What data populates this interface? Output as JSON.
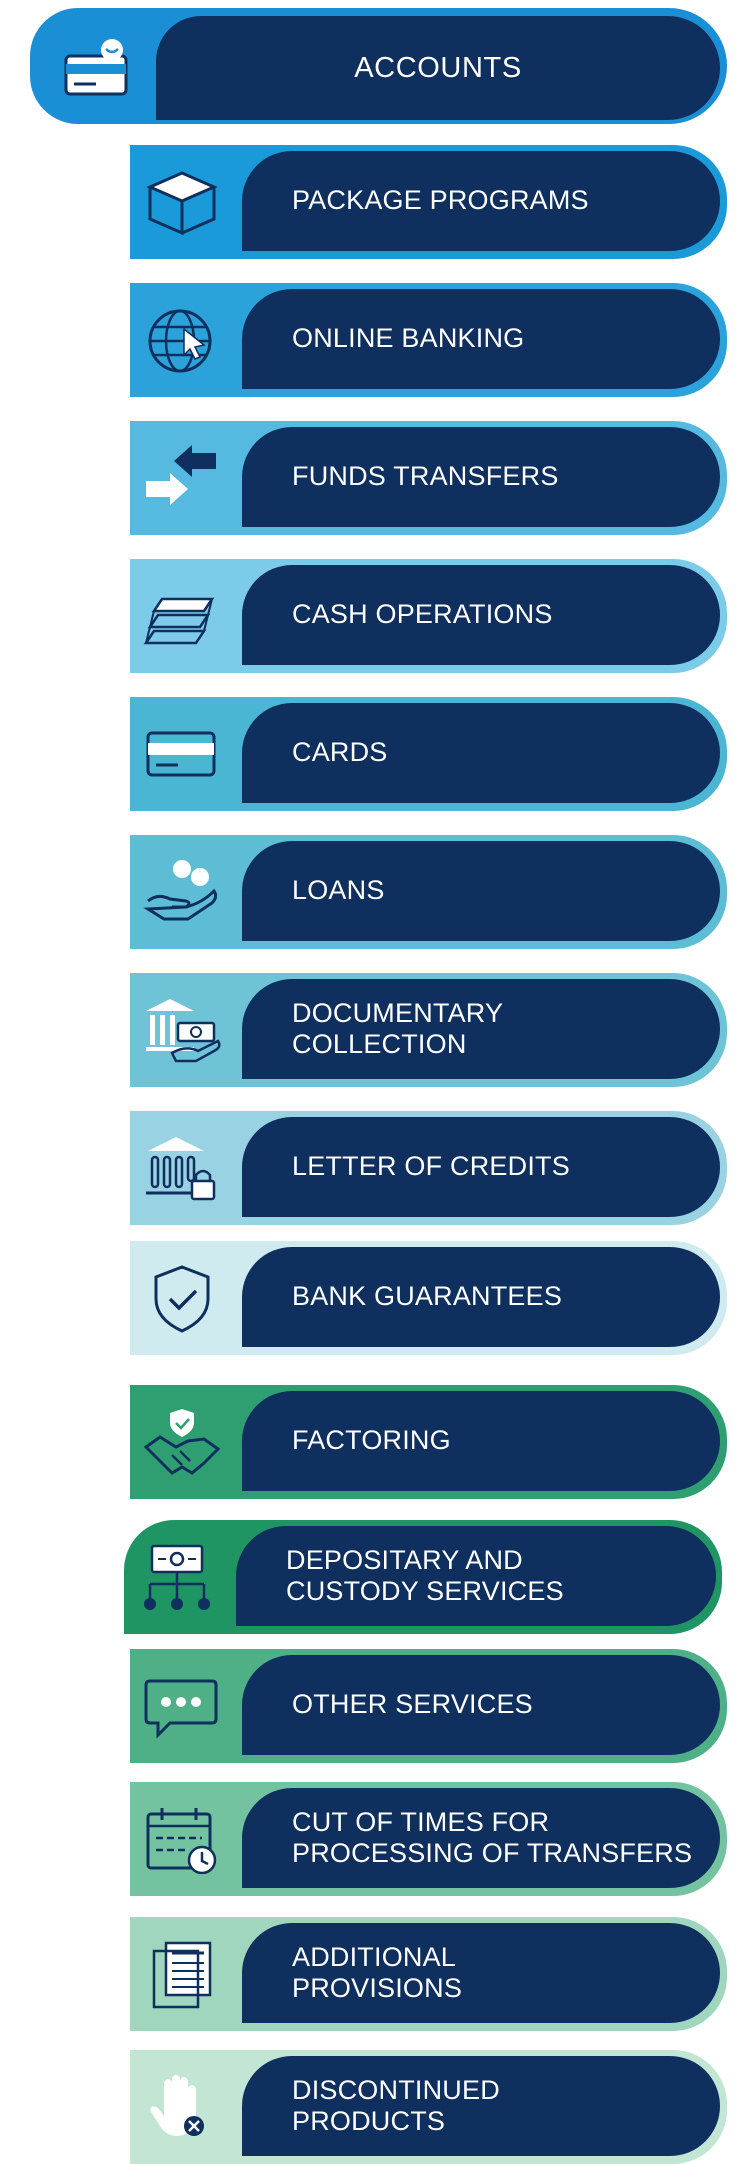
{
  "header": {
    "label": "ACCOUNTS",
    "icon": "account-icon",
    "color": "#1a8fd6"
  },
  "items": [
    {
      "label": "PACKAGE PROGRAMS",
      "icon": "box-icon",
      "color": "#1a9ad8"
    },
    {
      "label": "ONLINE BANKING",
      "icon": "globe-cursor-icon",
      "color": "#2ba2d9"
    },
    {
      "label": "FUNDS TRANSFERS",
      "icon": "transfer-arrows-icon",
      "color": "#56b9df"
    },
    {
      "label": "CASH OPERATIONS",
      "icon": "cash-stack-icon",
      "color": "#7ccbe8"
    },
    {
      "label": "CARDS",
      "icon": "card-icon",
      "color": "#4bb6d3"
    },
    {
      "label": "LOANS",
      "icon": "hand-coins-icon",
      "color": "#5dbdd5"
    },
    {
      "label": "DOCUMENTARY\nCOLLECTION",
      "icon": "bank-money-icon",
      "color": "#6ec3d7"
    },
    {
      "label": "LETTER OF CREDITS",
      "icon": "bank-lock-icon",
      "color": "#99d2e2"
    },
    {
      "label": "BANK GUARANTEES",
      "icon": "shield-check-icon",
      "color": "#d0ebf0"
    },
    {
      "label": "FACTORING",
      "icon": "handshake-icon",
      "color": "#2f9f72"
    },
    {
      "label": "DEPOSITARY AND\nCUSTODY SERVICES",
      "icon": "custody-network-icon",
      "color": "#1f9563"
    },
    {
      "label": "OTHER SERVICES",
      "icon": "chat-dots-icon",
      "color": "#4fb087"
    },
    {
      "label": "CUT OF TIMES FOR\nPROCESSING OF TRANSFERS",
      "icon": "calendar-clock-icon",
      "color": "#74c3a0"
    },
    {
      "label": "ADDITIONAL\nPROVISIONS",
      "icon": "documents-icon",
      "color": "#9fd6bd"
    },
    {
      "label": "DISCONTINUED\n PRODUCTS",
      "icon": "stop-hand-icon",
      "color": "#c2e6d3"
    }
  ]
}
